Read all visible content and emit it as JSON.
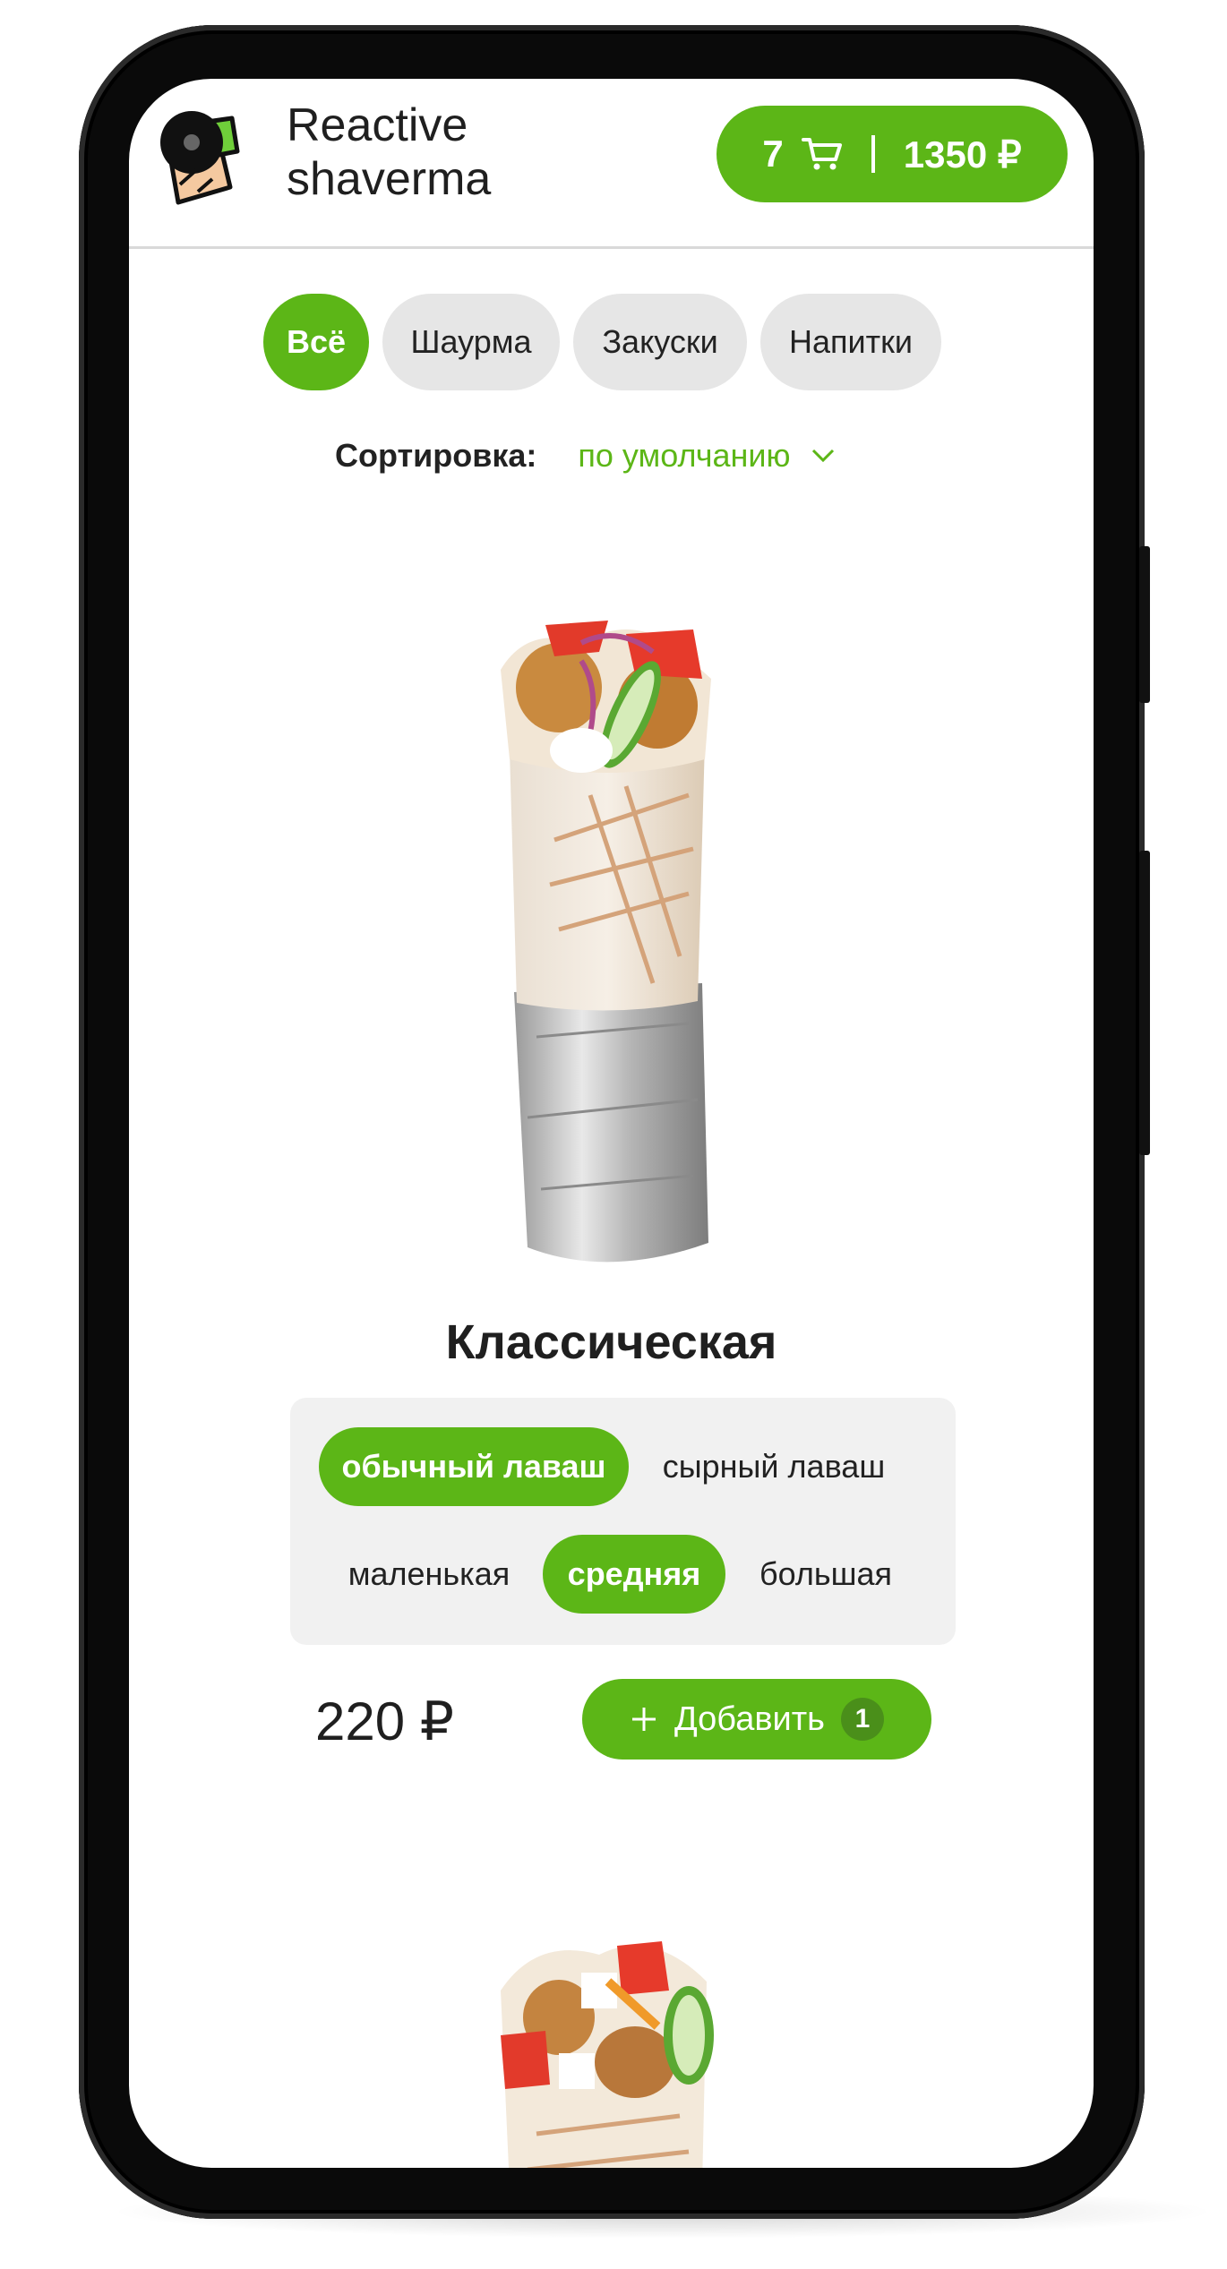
{
  "header": {
    "brand_line1": "Reactive",
    "brand_line2": "shaverma",
    "cart_count": "7",
    "cart_total": "1350 ₽"
  },
  "categories": [
    {
      "label": "Всё",
      "active": true
    },
    {
      "label": "Шаурма",
      "active": false
    },
    {
      "label": "Закуски",
      "active": false
    },
    {
      "label": "Напитки",
      "active": false
    }
  ],
  "sort": {
    "label": "Сортировка:",
    "value": "по умолчанию"
  },
  "product": {
    "title": "Классическая",
    "dough_options": [
      {
        "label": "обычный лаваш",
        "active": true
      },
      {
        "label": "сырный лаваш",
        "active": false
      }
    ],
    "size_options": [
      {
        "label": "маленькая",
        "active": false
      },
      {
        "label": "средняя",
        "active": true
      },
      {
        "label": "большая",
        "active": false
      }
    ],
    "price": "220 ₽",
    "add_label": "Добавить",
    "added_count": "1"
  },
  "colors": {
    "accent": "#5cb617",
    "chip_bg": "#e6e6e6",
    "options_bg": "#f1f1f1"
  },
  "icons": [
    "cart-icon",
    "chevron-down-icon",
    "plus-icon",
    "logo-icon"
  ]
}
